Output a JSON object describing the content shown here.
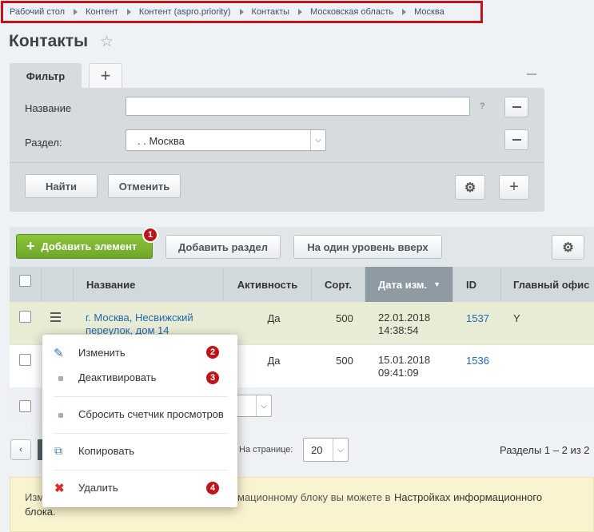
{
  "breadcrumb": [
    "Рабочий стол",
    "Контент",
    "Контент (aspro.priority)",
    "Контакты",
    "Московская область",
    "Москва"
  ],
  "page_title": "Контакты",
  "filter": {
    "tab_label": "Фильтр",
    "add_tab_label": "+",
    "name_label": "Название",
    "name_value": "",
    "help": "?",
    "section_label": "Раздел:",
    "section_value": ". . Москва",
    "find_label": "Найти",
    "cancel_label": "Отменить"
  },
  "toolbar": {
    "add_element_label": "Добавить элемент",
    "add_section_label": "Добавить раздел",
    "level_up_label": "На один уровень вверх"
  },
  "table": {
    "headers": {
      "name": "Название",
      "active": "Активность",
      "sort": "Сорт.",
      "date": "Дата изм.",
      "id": "ID",
      "office": "Главный офис"
    },
    "rows": [
      {
        "name": "г. Москва, Несвижский переулок, дом 14",
        "active": "Да",
        "sort": "500",
        "date": "22.01.2018 14:38:54",
        "id": "1537",
        "office": "Y"
      },
      {
        "name": "",
        "active": "Да",
        "sort": "500",
        "date": "15.01.2018 09:41:09",
        "id": "1536",
        "office": ""
      }
    ]
  },
  "context_menu": {
    "edit": "Изменить",
    "deactivate": "Деактивировать",
    "reset_views": "Сбросить счетчик просмотров",
    "copy": "Копировать",
    "delete": "Удалить"
  },
  "badges": [
    "1",
    "2",
    "3",
    "4"
  ],
  "pager": {
    "per_page_label": "На странице:",
    "per_page_value": "20",
    "sections_info": "Разделы 1 – 2 из 2"
  },
  "notice": {
    "text_start": "Изм",
    "text_mid": "мационному блоку вы можете в",
    "link": "Настройках информационного",
    "link_end": "блока."
  },
  "colors": {
    "accent_red": "#c4141b",
    "green": "#7cb433",
    "link": "#2067b0"
  }
}
